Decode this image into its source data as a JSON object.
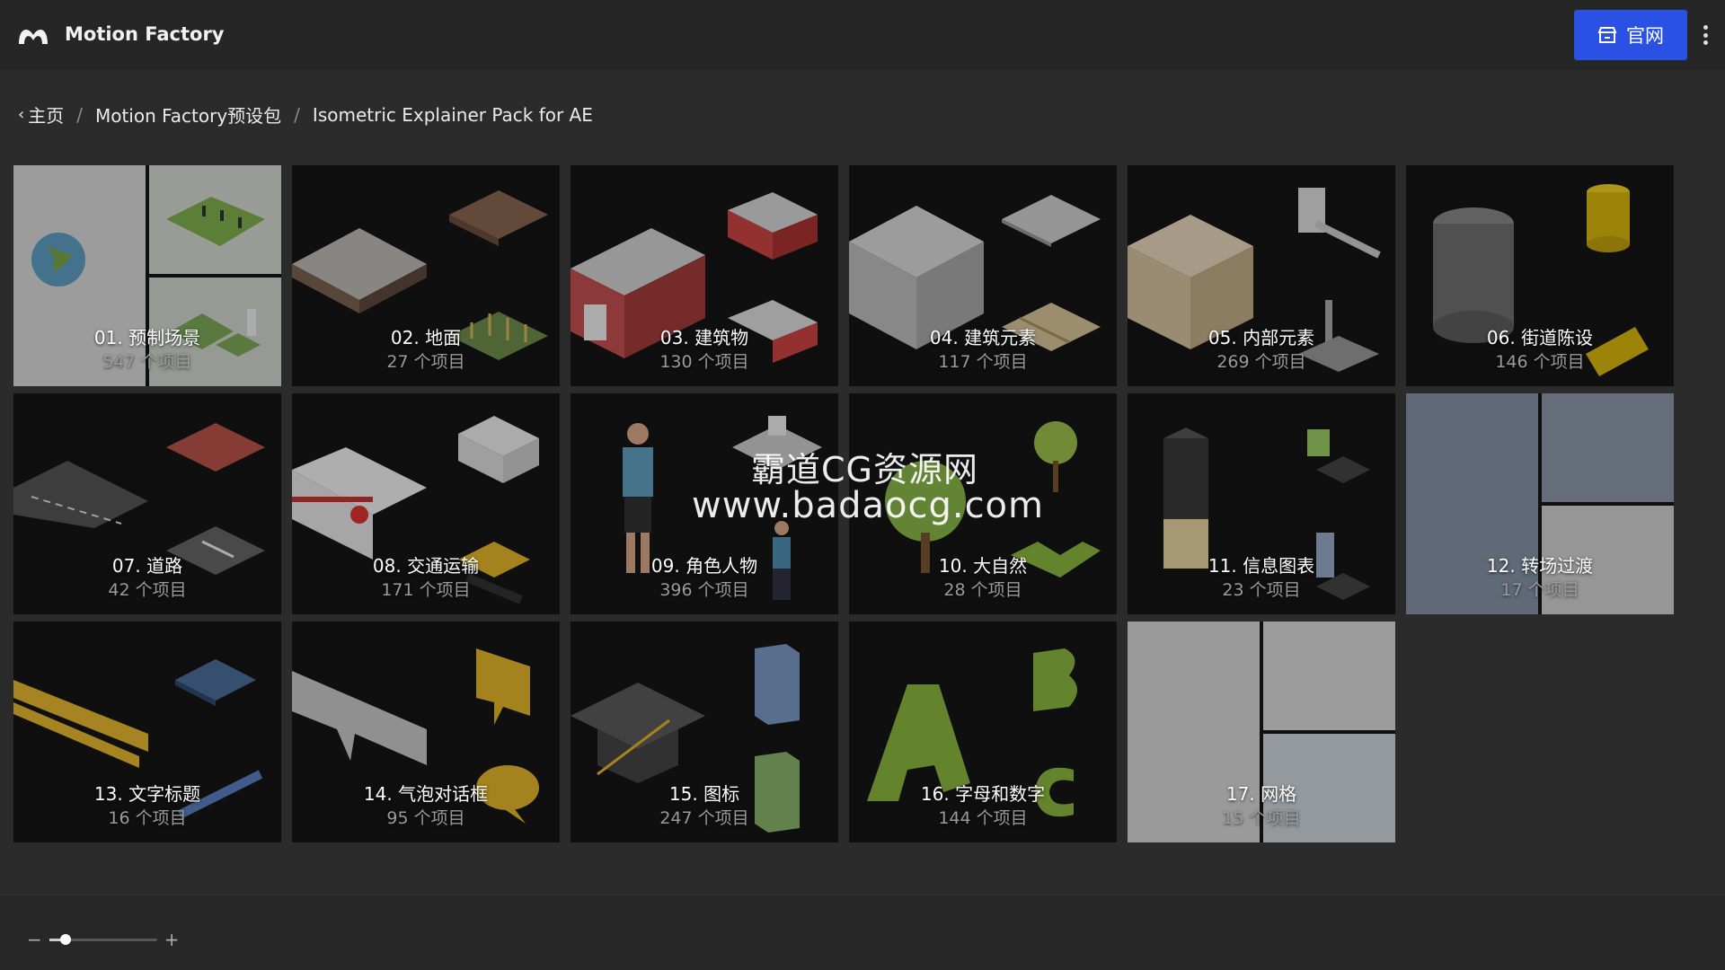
{
  "header": {
    "app_title": "Motion Factory",
    "site_button_label": "官网",
    "accent_color": "#2a50e4"
  },
  "breadcrumb": {
    "home": "主页",
    "level2": "Motion Factory预设包",
    "level3": "Isometric Explainer Pack for AE"
  },
  "tiles": [
    {
      "name": "01. 预制场景",
      "count": "547 个项目"
    },
    {
      "name": "02. 地面",
      "count": "27 个项目"
    },
    {
      "name": "03. 建筑物",
      "count": "130 个项目"
    },
    {
      "name": "04. 建筑元素",
      "count": "117 个项目"
    },
    {
      "name": "05. 内部元素",
      "count": "269 个项目"
    },
    {
      "name": "06. 街道陈设",
      "count": "146 个项目"
    },
    {
      "name": "07. 道路",
      "count": "42 个项目"
    },
    {
      "name": "08. 交通运输",
      "count": "171 个项目"
    },
    {
      "name": "09. 角色人物",
      "count": "396 个项目"
    },
    {
      "name": "10. 大自然",
      "count": "28 个项目"
    },
    {
      "name": "11. 信息图表",
      "count": "23 个项目"
    },
    {
      "name": "12. 转场过渡",
      "count": "17 个项目"
    },
    {
      "name": "13. 文字标题",
      "count": "16 个项目"
    },
    {
      "name": "14. 气泡对话框",
      "count": "95 个项目"
    },
    {
      "name": "15. 图标",
      "count": "247 个项目"
    },
    {
      "name": "16. 字母和数字",
      "count": "144 个项目"
    },
    {
      "name": "17. 网格",
      "count": "15 个项目"
    }
  ],
  "watermark": {
    "line1": "霸道CG资源网",
    "line2": "www.badaocg.com"
  },
  "zoom": {
    "minus": "−",
    "plus": "+",
    "level_fraction": 0.15
  }
}
